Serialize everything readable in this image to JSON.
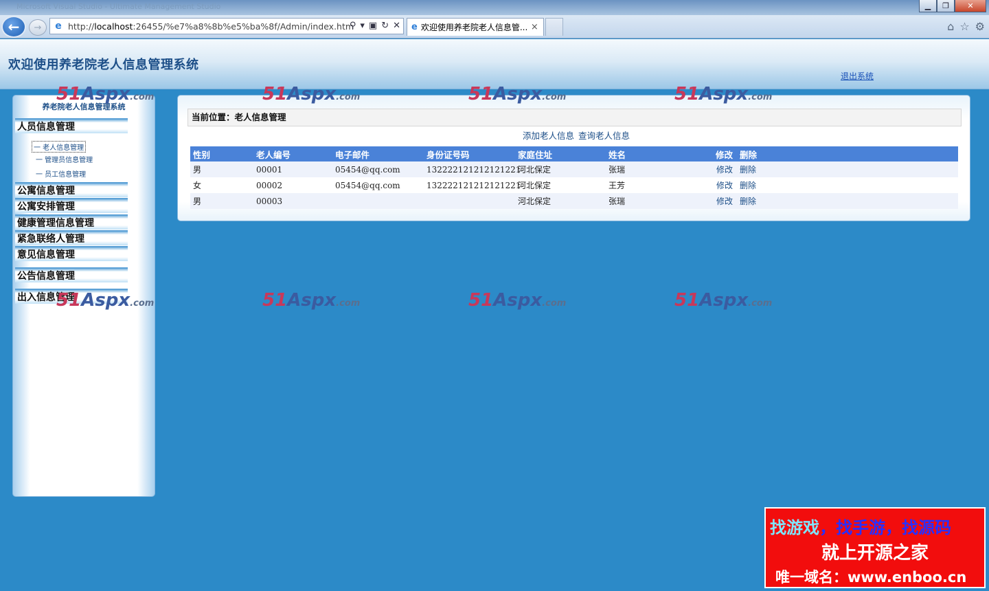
{
  "browser": {
    "window_title": "Microsoft Visual Studio - Ultimate Management Studio",
    "url_prefix": "http://",
    "url_host": "localhost",
    "url_rest": ":26455/%e7%a8%8b%e5%ba%8f/Admin/index.htm",
    "tab_title": "欢迎使用养老院老人信息管...",
    "tab_close": "×"
  },
  "header": {
    "site_title": "欢迎使用养老院老人信息管理系统",
    "logout_label": "退出系统"
  },
  "sidebar": {
    "title": "养老院老人信息管理系统",
    "groups": [
      {
        "label": "人员信息管理"
      },
      {
        "label": "公寓信息管理"
      },
      {
        "label": "公寓安排管理"
      },
      {
        "label": "健康管理信息管理"
      },
      {
        "label": "紧急联络人管理"
      },
      {
        "label": "意见信息管理"
      },
      {
        "label": "公告信息管理"
      },
      {
        "label": "出入信息管理"
      }
    ],
    "subitems": [
      {
        "label": "一  老人信息管理"
      },
      {
        "label": "一  管理员信息管理"
      },
      {
        "label": "一  员工信息管理"
      }
    ]
  },
  "main": {
    "breadcrumb": "当前位置：老人信息管理",
    "add_link": "添加老人信息",
    "query_link": "查询老人信息",
    "columns": [
      "性别",
      "老人编号",
      "电子邮件",
      "身份证号码",
      "家庭住址",
      "姓名",
      "修改",
      "删除"
    ],
    "rows": [
      {
        "gender": "男",
        "id": "00001",
        "email": "05454@qq.com",
        "idcard": "132222121212121221",
        "address": "河北保定",
        "name": "张瑞",
        "edit": "修改",
        "delete": "删除"
      },
      {
        "gender": "女",
        "id": "00002",
        "email": "05454@qq.com",
        "idcard": "132222121212121221",
        "address": "河北保定",
        "name": "王芳",
        "edit": "修改",
        "delete": "删除"
      },
      {
        "gender": "男",
        "id": "00003",
        "email": "",
        "idcard": "",
        "address": "河北保定",
        "name": "张瑞",
        "edit": "修改",
        "delete": "删除"
      }
    ]
  },
  "watermark": {
    "num": "51",
    "brand": "Aspx",
    "suffix": ".com"
  },
  "ad": {
    "line1_a": "找游戏",
    "line1_b": "，找手游，找源码",
    "line2": "就上开源之家",
    "line3": "唯一域名：www.enboo.cn"
  },
  "colors": {
    "page_bg": "#2c8ac8",
    "grid_header": "#4a82d8",
    "link": "#1d4f88",
    "ad_bg": "#f20d0d"
  }
}
